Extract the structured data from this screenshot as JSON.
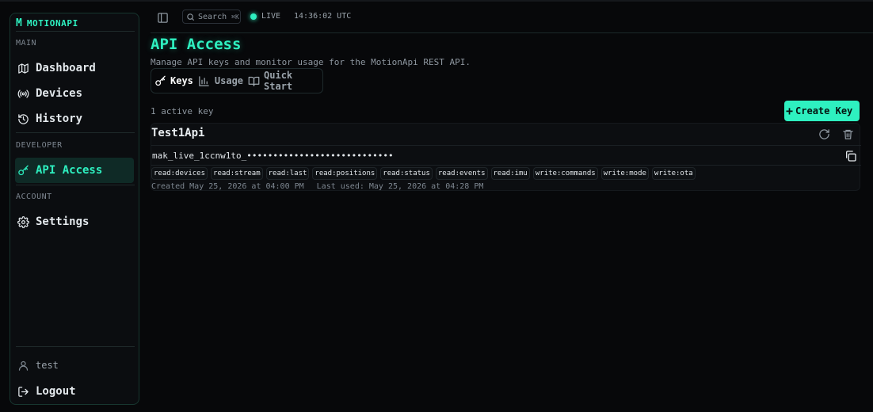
{
  "brand": {
    "logo": "M",
    "name": "MOTIONAPI"
  },
  "sidebar": {
    "sections": [
      {
        "label": "MAIN"
      },
      {
        "label": "DEVELOPER"
      },
      {
        "label": "ACCOUNT"
      }
    ],
    "items": [
      {
        "label": "Dashboard",
        "icon": "map-icon"
      },
      {
        "label": "Devices",
        "icon": "broadcast-icon"
      },
      {
        "label": "History",
        "icon": "history-icon"
      },
      {
        "label": "API Access",
        "icon": "key-icon",
        "active": true
      },
      {
        "label": "Settings",
        "icon": "gear-icon"
      }
    ],
    "user": "test",
    "logout": "Logout"
  },
  "topbar": {
    "search_label": "Search",
    "search_shortcut": "⌘K",
    "live_label": "LIVE",
    "clock": "14:36:02 UTC"
  },
  "page": {
    "title": "API Access",
    "subtitle": "Manage API keys and monitor usage for the MotionApi REST API.",
    "tabs": [
      {
        "label": "Keys",
        "icon": "key-icon",
        "active": true
      },
      {
        "label": "Usage",
        "icon": "bar-chart-icon"
      },
      {
        "label": "Quick Start",
        "icon": "book-icon"
      }
    ],
    "active_count": "1 active key",
    "create_button": "Create Key"
  },
  "key": {
    "name": "Test1Api",
    "value": "mak_live_1ccnw1to_••••••••••••••••••••••••••••",
    "scopes": [
      "read:devices",
      "read:stream",
      "read:last",
      "read:positions",
      "read:status",
      "read:events",
      "read:imu",
      "write:commands",
      "write:mode",
      "write:ota"
    ],
    "created": "Created May 25, 2026 at 04:00 PM",
    "last_used": "Last used: May 25, 2026 at 04:28 PM"
  },
  "colors": {
    "accent": "#2ef0c0",
    "background": "#07080a"
  }
}
